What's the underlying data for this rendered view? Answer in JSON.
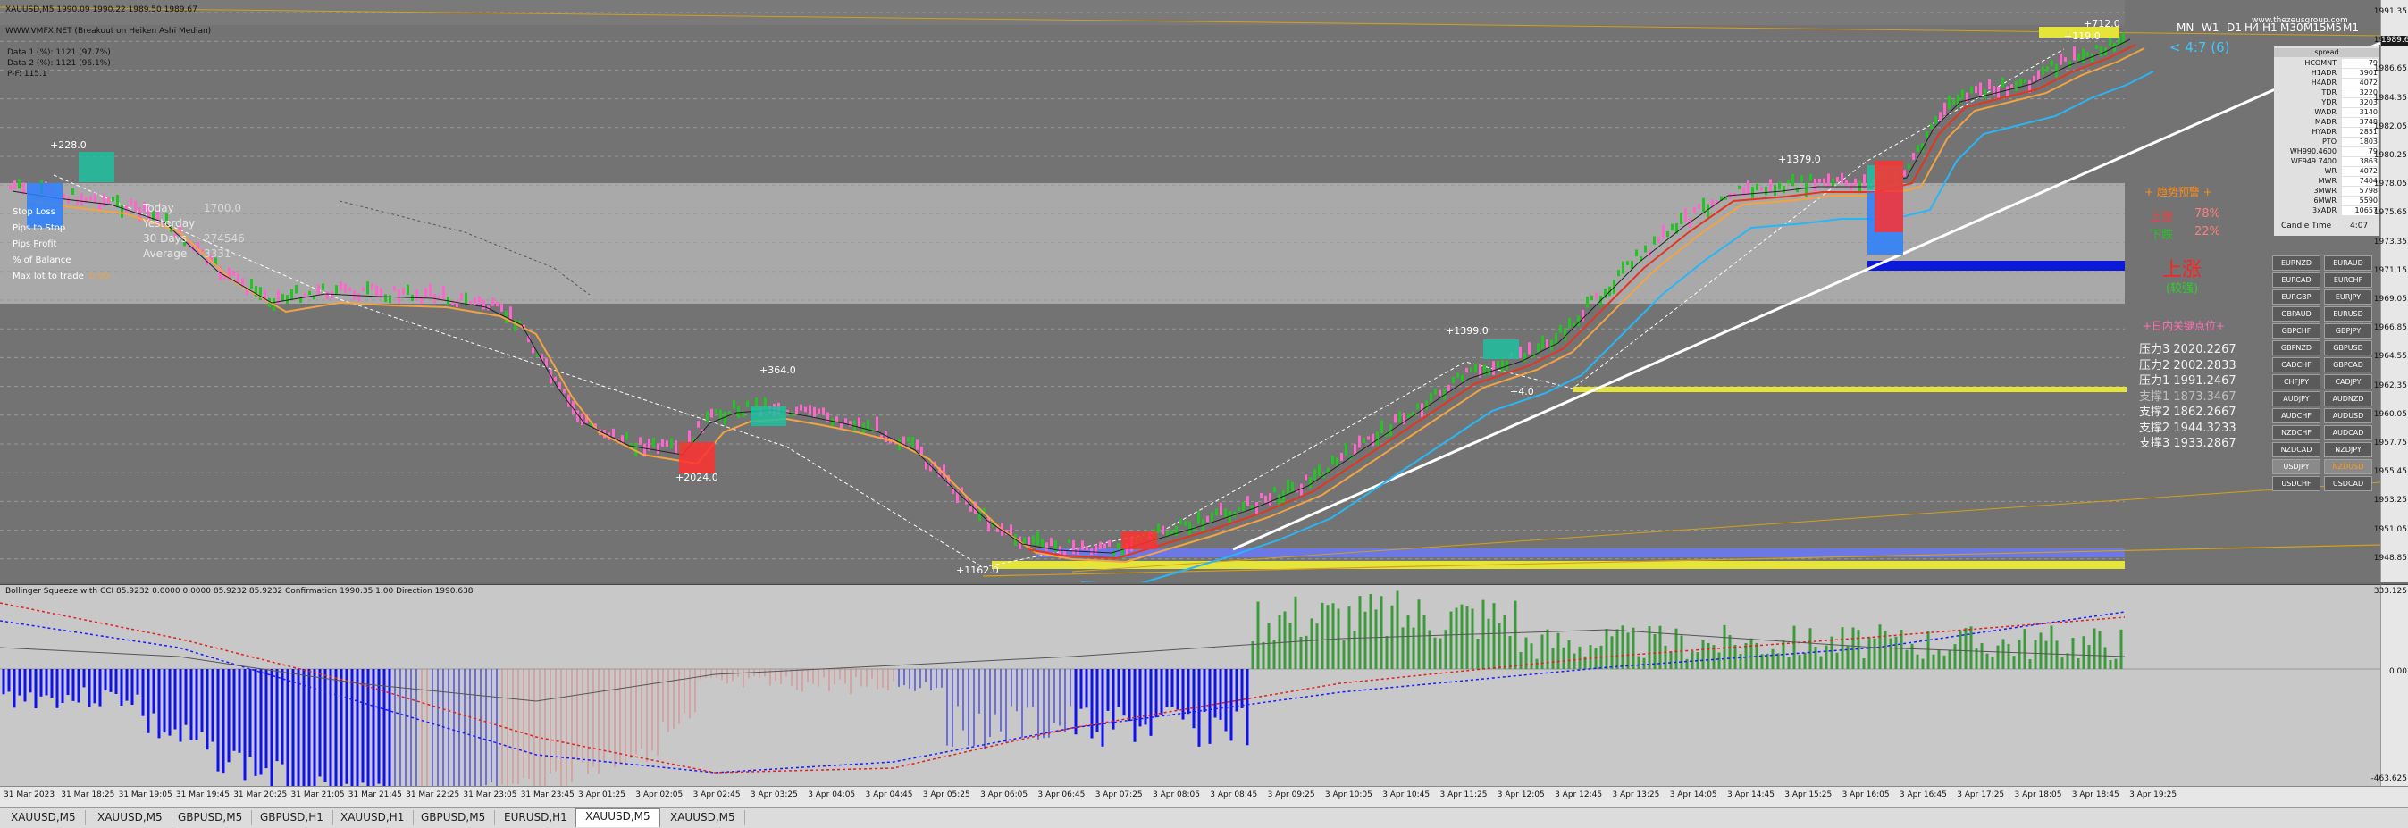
{
  "header": {
    "symbol_line": "XAUUSD,M5  1990.09 1990.22 1989.50 1989.67",
    "indicator_line": "WWW.VMFX.NET (Breakout on Heiken Ashi Median)",
    "data1": "Data 1 (%): 1121 (97.7%)",
    "data2": "Data 2 (%): 1121 (96.1%)",
    "pf": "P-F: 115.1",
    "watermark": "www.thezeusgroup.com"
  },
  "timeframes": [
    "MN",
    "W1",
    "D1",
    "H4",
    "H1",
    "M30",
    "M15",
    "M5",
    "M1"
  ],
  "countdown": "< 4:7 (6)",
  "left_panel": {
    "items": [
      {
        "label": "Stop Loss",
        "value": ""
      },
      {
        "label": "Pips to Stop",
        "value": ""
      },
      {
        "label": "Pips Profit",
        "value": ""
      },
      {
        "label": "% of Balance",
        "value": ""
      },
      {
        "label": "Max lot to trade",
        "value": "0.00"
      }
    ],
    "stats": [
      {
        "label": "Today",
        "value": "1700.0"
      },
      {
        "label": "Yesterday",
        "value": ""
      },
      {
        "label": "30 Days",
        "value": "274546"
      },
      {
        "label": "Average",
        "value": "3331"
      }
    ]
  },
  "trade_labels": [
    "+228.0",
    "+2024.0",
    "+364.0",
    "+1162.0",
    "+1399.0",
    "+4.0",
    "+1379.0",
    "+712.0",
    "+119.0"
  ],
  "right_stats": {
    "title": "spread",
    "rows": [
      {
        "label": "HCOMNT",
        "value": "79"
      },
      {
        "label": "H1ADR",
        "value": "3901"
      },
      {
        "label": "H4ADR",
        "value": "4072"
      },
      {
        "label": "TDR",
        "value": "3220"
      },
      {
        "label": "YDR",
        "value": "3203"
      },
      {
        "label": "WADR",
        "value": "3140"
      },
      {
        "label": "MADR",
        "value": "3748"
      },
      {
        "label": "HYADR",
        "value": "2851"
      },
      {
        "label": "PTO",
        "value": "1803"
      },
      {
        "label": "WH990.4600",
        "value": "79"
      },
      {
        "label": "WE949.7400",
        "value": "3863"
      },
      {
        "label": "WR",
        "value": "4072"
      },
      {
        "label": "MWR",
        "value": "7404"
      },
      {
        "label": "3MWR",
        "value": "5798"
      },
      {
        "label": "6MWR",
        "value": "5590"
      },
      {
        "label": "3xADR",
        "value": "10657"
      }
    ],
    "candle_time_label": "Candle Time",
    "candle_time_value": "4:07"
  },
  "sentiment": {
    "header": "+ 趋势预警 +",
    "up_label": "上涨",
    "up_pct": "78%",
    "down_label": "下跌",
    "down_pct": "22%",
    "big_label": "上涨",
    "big_sub": "(较强)",
    "levels_header": "+日内关键点位+",
    "levels": [
      "压力3 2020.2267",
      "压力2 2002.2833",
      "压力1 1991.2467",
      "支撑1 1873.3467",
      "支撑2 1862.2667",
      "支撑2 1944.3233",
      "支撑3 1933.2867"
    ]
  },
  "symbols": [
    [
      "EURNZD",
      "EURAUD"
    ],
    [
      "EURCAD",
      "EURCHF"
    ],
    [
      "EURGBP",
      "EURJPY"
    ],
    [
      "GBPAUD",
      "EURUSD"
    ],
    [
      "GBPCHF",
      "GBPJPY"
    ],
    [
      "GBPNZD",
      "GBPUSD"
    ],
    [
      "CADCHF",
      "GBPCAD"
    ],
    [
      "CHFJPY",
      "CADJPY"
    ],
    [
      "AUDJPY",
      "AUDNZD"
    ],
    [
      "AUDCHF",
      "AUDUSD"
    ],
    [
      "NZDCHF",
      "AUDCAD"
    ],
    [
      "NZDCAD",
      "NZDJPY"
    ],
    [
      "USDJPY",
      "NZDUSD"
    ],
    [
      "USDCHF",
      "USDCAD"
    ]
  ],
  "price_axis": [
    "1991.35",
    "1988.95",
    "1986.65",
    "1984.35",
    "1982.05",
    "1980.25",
    "1978.05",
    "1975.65",
    "1973.35",
    "1971.15",
    "1969.05",
    "1966.85",
    "1964.55",
    "1962.35",
    "1960.05",
    "1957.75",
    "1955.45",
    "1953.25",
    "1951.05",
    "1948.85"
  ],
  "current_price": "1989.67",
  "sub_indicator": {
    "label": "Bollinger Squeeze with CCI 85.9232 0.0000 0.0000 85.9232 85.9232  Confirmation 1990.35 1.00  Direction 1990.638",
    "axis": [
      "333.125",
      "0.00",
      "-463.625"
    ]
  },
  "time_axis": [
    "31 Mar 2023",
    "31 Mar 18:25",
    "31 Mar 19:05",
    "31 Mar 19:45",
    "31 Mar 20:25",
    "31 Mar 21:05",
    "31 Mar 21:45",
    "31 Mar 22:25",
    "31 Mar 23:05",
    "31 Mar 23:45",
    "3 Apr 01:25",
    "3 Apr 02:05",
    "3 Apr 02:45",
    "3 Apr 03:25",
    "3 Apr 04:05",
    "3 Apr 04:45",
    "3 Apr 05:25",
    "3 Apr 06:05",
    "3 Apr 06:45",
    "3 Apr 07:25",
    "3 Apr 08:05",
    "3 Apr 08:45",
    "3 Apr 09:25",
    "3 Apr 10:05",
    "3 Apr 10:45",
    "3 Apr 11:25",
    "3 Apr 12:05",
    "3 Apr 12:45",
    "3 Apr 13:25",
    "3 Apr 14:05",
    "3 Apr 14:45",
    "3 Apr 15:25",
    "3 Apr 16:05",
    "3 Apr 16:45",
    "3 Apr 17:25",
    "3 Apr 18:05",
    "3 Apr 18:45",
    "3 Apr 19:25"
  ],
  "tabs": [
    "XAUUSD,M5",
    "XAUUSD,M5",
    "GBPUSD,M5",
    "GBPUSD,H1",
    "XAUUSD,H1",
    "GBPUSD,M5",
    "EURUSD,H1",
    "XAUUSD,M5",
    "XAUUSD,M5"
  ],
  "active_tab": 7,
  "colors": {
    "bull": "#22c322",
    "bear": "#ff66cc",
    "ma_orange": "#f4a340",
    "ma_blue": "#29b6f6",
    "ma_red": "#e8341c",
    "trend_white": "#ffffff",
    "level_yellow": "#e5e43a",
    "level_blue": "#6b79f0"
  }
}
